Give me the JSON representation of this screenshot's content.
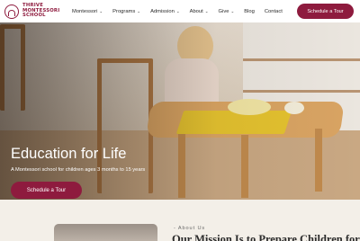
{
  "brand": {
    "name_line1": "THRIVE",
    "name_line2": "MONTESSORI",
    "name_line3": "SCHOOL",
    "color": "#8e1b3e"
  },
  "nav": {
    "items": [
      {
        "label": "Montessori",
        "has_dropdown": true
      },
      {
        "label": "Programs",
        "has_dropdown": true
      },
      {
        "label": "Admission",
        "has_dropdown": true
      },
      {
        "label": "About",
        "has_dropdown": true
      },
      {
        "label": "Give",
        "has_dropdown": true
      },
      {
        "label": "Blog",
        "has_dropdown": false
      },
      {
        "label": "Contact",
        "has_dropdown": false
      }
    ],
    "caret": "⌄",
    "cta_label": "Schedule a Tour"
  },
  "hero": {
    "title": "Education for Life",
    "subtitle": "A Montessori school for children ages 3 months to 15 years",
    "cta_label": "Schedule a Tour"
  },
  "about": {
    "eyebrow": "- About Us",
    "heading": "Our Mission Is to Prepare Children for"
  }
}
